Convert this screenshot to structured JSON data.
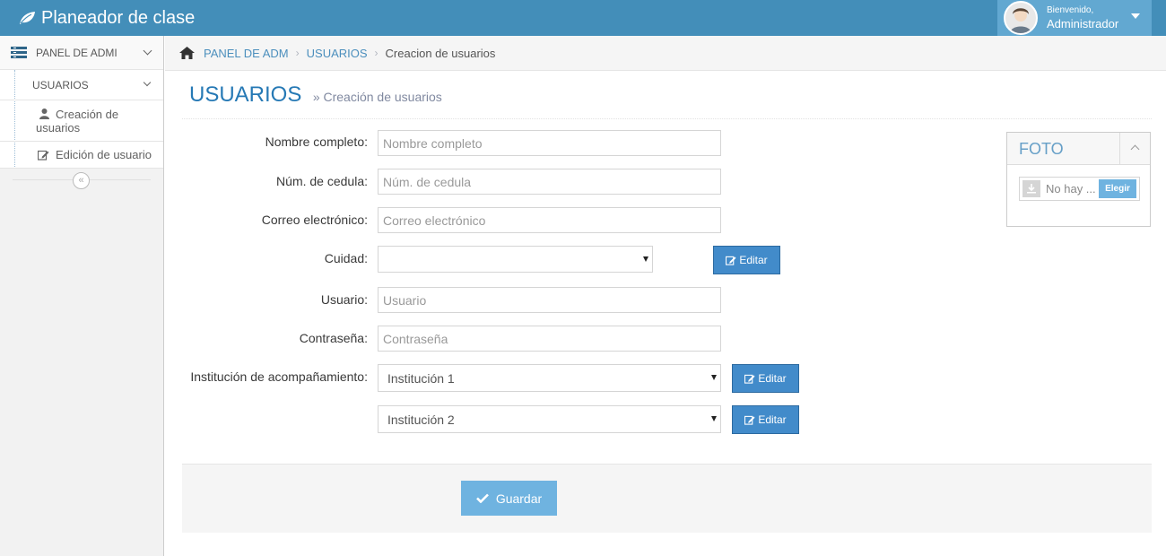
{
  "app": {
    "title": "Planeador de clase"
  },
  "user": {
    "greeting": "Bienvenido,",
    "name": "Administrador"
  },
  "sidebar": {
    "panel_label": "PANEL DE ADMI",
    "section_label": "USUARIOS",
    "items": [
      {
        "line1": "Creación de",
        "line2": "usuarios"
      },
      {
        "label": "Edición de usuario"
      }
    ],
    "collapse_glyph": "«"
  },
  "breadcrumb": {
    "items": [
      "PANEL DE ADM",
      "USUARIOS"
    ],
    "active": "Creacion de usuarios",
    "separator": "›"
  },
  "page": {
    "title": "USUARIOS",
    "subtitle": "» Creación de usuarios"
  },
  "form": {
    "nombre": {
      "label": "Nombre completo:",
      "placeholder": "Nombre completo",
      "value": ""
    },
    "cedula": {
      "label": "Núm. de cedula:",
      "placeholder": "Núm. de cedula",
      "value": ""
    },
    "correo": {
      "label": "Correo electrónico:",
      "placeholder": "Correo electrónico",
      "value": ""
    },
    "ciudad": {
      "label": "Cuidad:",
      "value": ""
    },
    "usuario": {
      "label": "Usuario:",
      "placeholder": "Usuario",
      "value": ""
    },
    "contrasena": {
      "label": "Contraseña:",
      "placeholder": "Contraseña",
      "value": ""
    },
    "institucion": {
      "label": "Institución de acompañamiento:",
      "value1": "Institución 1",
      "value2": "Institución 2"
    },
    "edit_label": "Editar",
    "save_label": "Guardar"
  },
  "foto": {
    "title": "FOTO",
    "file_text": "No hay ...",
    "choose_label": "Elegir"
  },
  "colors": {
    "navbar": "#438eb9",
    "accent": "#428bca",
    "save": "#6fb3e0",
    "title": "#2679b5"
  }
}
